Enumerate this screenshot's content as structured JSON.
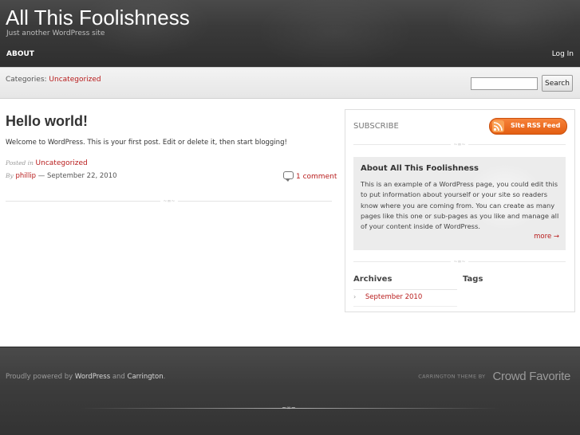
{
  "header": {
    "site_title": "All This Foolishness",
    "tagline": "Just another WordPress site",
    "nav_about": "ABOUT",
    "login": "Log In"
  },
  "category_bar": {
    "label": "Categories:",
    "category": "Uncategorized",
    "search_value": "",
    "search_button": "Search"
  },
  "post": {
    "title": "Hello world!",
    "body": "Welcome to WordPress. This is your first post. Edit or delete it, then start blogging!",
    "posted_in_label": "Posted in",
    "posted_in_value": "Uncategorized",
    "by_label": "By",
    "author": "phillip",
    "date_sep": "—",
    "date": "September 22, 2010",
    "comments": "1 comment"
  },
  "sidebar": {
    "subscribe": "SUBSCRIBE",
    "rss_button": "Site RSS Feed",
    "about_title": "About All This Foolishness",
    "about_text": "This is an example of a WordPress page, you could edit this to put information about yourself or your site so readers know where you are coming from. You can create as many pages like this one or sub-pages as you like and manage all of your content inside of WordPress.",
    "about_more": "more →",
    "archives_title": "Archives",
    "tags_title": "Tags",
    "archives": [
      "September 2010"
    ]
  },
  "footer": {
    "powered_prefix": "Proudly powered by",
    "wordpress": "WordPress",
    "and": "and",
    "carrington": "Carrington",
    "period": ".",
    "badge_small": "CARRINGTON THEME BY",
    "badge_big": "Crowd Favorite"
  },
  "colors": {
    "link": "#b81b1b",
    "rss_orange": "#f26c1f",
    "header_bg": "#3a3a3a"
  }
}
